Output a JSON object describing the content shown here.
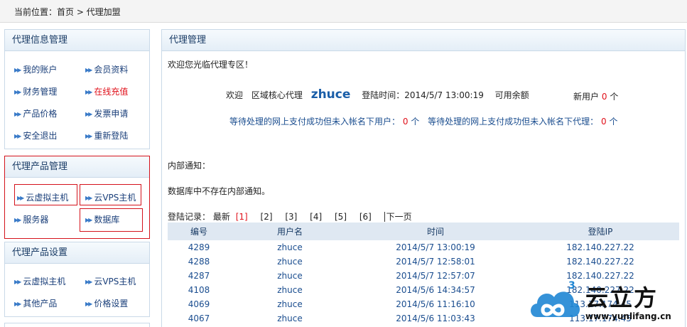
{
  "breadcrumb": "当前位置：首页 > 代理加盟",
  "sidebar": {
    "section1": {
      "title": "代理信息管理",
      "items": [
        {
          "label": "我的账户"
        },
        {
          "label": "会员资料"
        },
        {
          "label": "财务管理"
        },
        {
          "label": "在线充值"
        },
        {
          "label": "产品价格"
        },
        {
          "label": "发票申请"
        },
        {
          "label": "安全退出"
        },
        {
          "label": "重新登陆"
        }
      ]
    },
    "section2": {
      "title": "代理产品管理",
      "items": [
        {
          "label": "云虚拟主机"
        },
        {
          "label": "云VPS主机"
        },
        {
          "label": "服务器"
        },
        {
          "label": "数据库"
        }
      ]
    },
    "section3": {
      "title": "代理产品设置",
      "items": [
        {
          "label": "云虚拟主机"
        },
        {
          "label": "云VPS主机"
        },
        {
          "label": "其他产品"
        },
        {
          "label": "价格设置"
        }
      ]
    }
  },
  "main": {
    "title": "代理管理",
    "welcome": "欢迎您光临代理专区！",
    "info": {
      "greet": "欢迎",
      "role": "区域核心代理",
      "username": "zhuce",
      "login_time_label": "登陆时间：2014/5/7 13:00:19",
      "balance_label": "可用余额",
      "new_users_label": "新用户",
      "new_users_count": "0",
      "unit": "个"
    },
    "pending": {
      "users_label": "等待处理的网上支付成功但未入帐名下用户：",
      "users_count": "0",
      "agents_label": "等待处理的网上支付成功但未入帐名下代理：",
      "agents_count": "0",
      "unit": "个"
    },
    "notice_label": "内部通知：",
    "notice_text": "数据库中不存在内部通知。",
    "login_records": {
      "label": "登陆记录：",
      "latest": "最新",
      "pages": [
        "[1]",
        "[2]",
        "[3]",
        "[4]",
        "[5]",
        "[6]"
      ],
      "next": "下一页",
      "columns": [
        "编号",
        "用户名",
        "时间",
        "登陆IP"
      ],
      "rows": [
        [
          "4289",
          "zhuce",
          "2014/5/7 13:00:19",
          "182.140.227.22"
        ],
        [
          "4288",
          "zhuce",
          "2014/5/7 12:58:01",
          "182.140.227.22"
        ],
        [
          "4287",
          "zhuce",
          "2014/5/7 12:57:07",
          "182.140.227.22"
        ],
        [
          "4108",
          "zhuce",
          "2014/5/6 14:34:57",
          "182.140.227.22"
        ],
        [
          "4069",
          "zhuce",
          "2014/5/6 11:16:10",
          "113.17.174.45"
        ],
        [
          "4067",
          "zhuce",
          "2014/5/6 11:03:43",
          "113.17.174.45"
        ]
      ]
    }
  },
  "watermark": {
    "text": "云立方",
    "url": "www.yunlifang.cn"
  }
}
